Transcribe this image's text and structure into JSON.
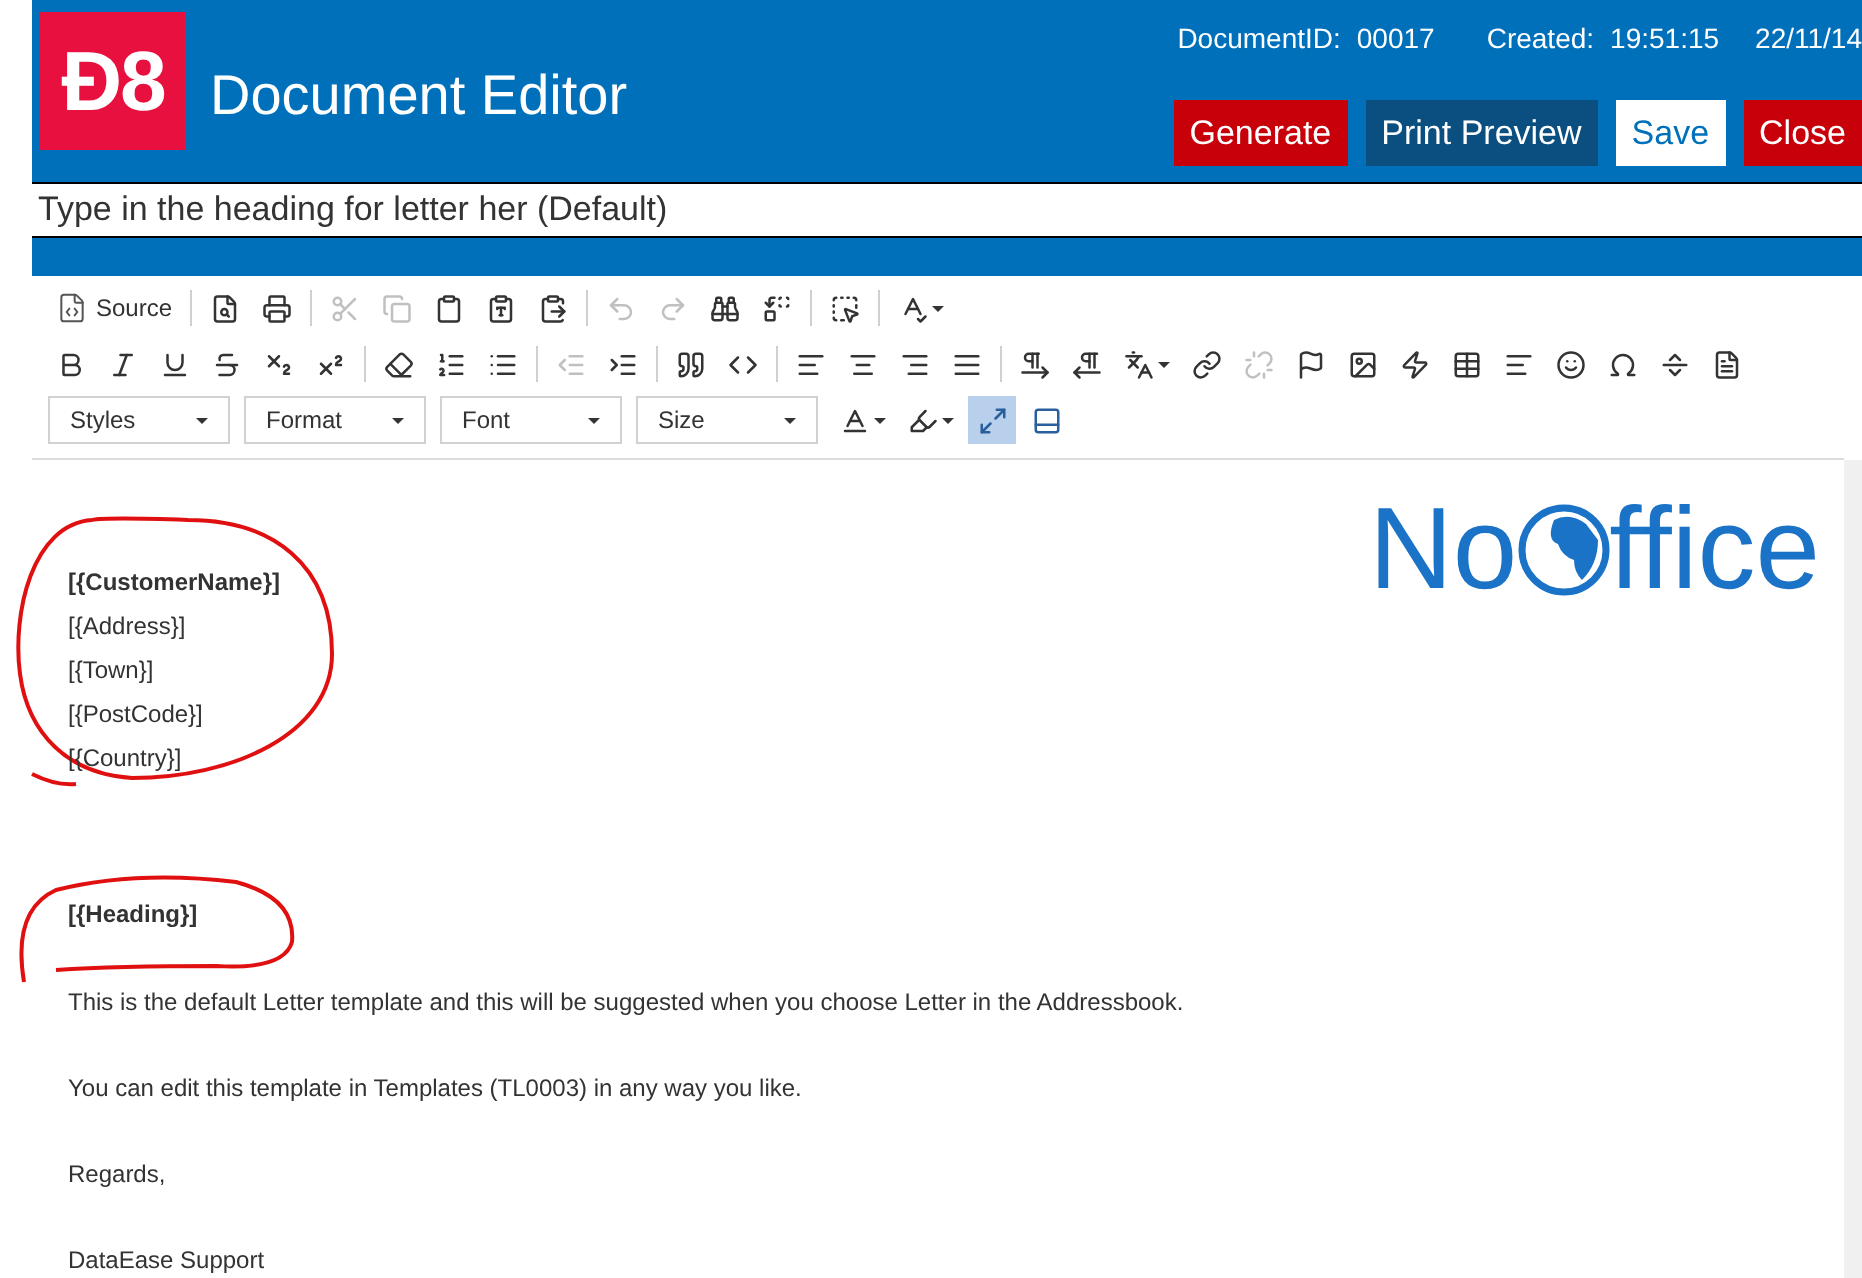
{
  "header": {
    "logo": "Đ8",
    "title": "Document Editor",
    "document_id_label": "DocumentID:",
    "document_id": "00017",
    "created_label": "Created:",
    "created_time": "19:51:15",
    "created_date": "22/11/14",
    "buttons": [
      {
        "label": "Generate",
        "kind": "danger"
      },
      {
        "label": "Print Preview",
        "kind": "dark"
      },
      {
        "label": "Save",
        "kind": "light"
      },
      {
        "label": "Close",
        "kind": "danger"
      }
    ]
  },
  "heading_field": {
    "value": "Type in the heading for letter her (Default)"
  },
  "toolbar": {
    "rows": [
      [
        {
          "kind": "source",
          "label": "Source"
        },
        {
          "kind": "separator"
        },
        {
          "kind": "icon",
          "disabled": false
        },
        {
          "kind": "icon",
          "disabled": false
        },
        {
          "kind": "separator"
        },
        {
          "kind": "icon",
          "disabled": true
        },
        {
          "kind": "icon",
          "disabled": true
        },
        {
          "kind": "icon",
          "disabled": false
        },
        {
          "kind": "icon",
          "disabled": false
        },
        {
          "kind": "icon",
          "disabled": false
        },
        {
          "kind": "separator"
        },
        {
          "kind": "icon",
          "disabled": true
        },
        {
          "kind": "icon",
          "disabled": true
        },
        {
          "kind": "icon",
          "disabled": false
        },
        {
          "kind": "icon",
          "disabled": false
        },
        {
          "kind": "separator"
        },
        {
          "kind": "icon",
          "disabled": false
        },
        {
          "kind": "separator"
        },
        {
          "kind": "icon-dropdown",
          "disabled": false
        }
      ],
      [
        {
          "kind": "icon",
          "disabled": false
        },
        {
          "kind": "icon",
          "disabled": false
        },
        {
          "kind": "icon",
          "disabled": false
        },
        {
          "kind": "icon",
          "disabled": false
        },
        {
          "kind": "icon",
          "disabled": false
        },
        {
          "kind": "icon",
          "disabled": false
        },
        {
          "kind": "separator"
        },
        {
          "kind": "icon",
          "disabled": false
        },
        {
          "kind": "icon",
          "disabled": false
        },
        {
          "kind": "icon",
          "disabled": false
        },
        {
          "kind": "separator"
        },
        {
          "kind": "icon",
          "disabled": true
        },
        {
          "kind": "icon",
          "disabled": false
        },
        {
          "kind": "separator"
        },
        {
          "kind": "icon",
          "disabled": false
        },
        {
          "kind": "icon",
          "disabled": false
        },
        {
          "kind": "separator"
        },
        {
          "kind": "icon",
          "disabled": false
        },
        {
          "kind": "icon",
          "disabled": false
        },
        {
          "kind": "icon",
          "disabled": false
        },
        {
          "kind": "icon",
          "disabled": false
        },
        {
          "kind": "separator"
        },
        {
          "kind": "icon",
          "disabled": false
        },
        {
          "kind": "icon",
          "disabled": false
        },
        {
          "kind": "icon-dropdown",
          "disabled": false
        },
        {
          "kind": "icon",
          "disabled": false
        },
        {
          "kind": "icon",
          "disabled": true
        },
        {
          "kind": "icon",
          "disabled": false
        },
        {
          "kind": "icon",
          "disabled": false
        },
        {
          "kind": "icon",
          "disabled": false
        },
        {
          "kind": "icon",
          "disabled": false
        },
        {
          "kind": "icon",
          "disabled": false
        },
        {
          "kind": "icon",
          "disabled": false
        },
        {
          "kind": "icon",
          "disabled": false
        },
        {
          "kind": "icon",
          "disabled": false
        },
        {
          "kind": "icon",
          "disabled": false
        }
      ],
      [
        {
          "kind": "combo",
          "label": "Styles"
        },
        {
          "kind": "combo",
          "label": "Format"
        },
        {
          "kind": "combo",
          "label": "Font"
        },
        {
          "kind": "combo",
          "label": "Size"
        },
        {
          "kind": "icon-dropdown",
          "disabled": false
        },
        {
          "kind": "icon-dropdown",
          "disabled": false
        },
        {
          "kind": "toggle",
          "selected": true
        },
        {
          "kind": "toggle",
          "selected": false
        }
      ]
    ]
  },
  "document": {
    "logo_start": "No",
    "logo_end": "ffice",
    "address": [
      {
        "text": "[{CustomerName}]",
        "bold": true
      },
      {
        "text": "[{Address}]",
        "bold": false
      },
      {
        "text": "[{Town}]",
        "bold": false
      },
      {
        "text": "[{PostCode}]",
        "bold": false
      },
      {
        "text": "[{Country}]",
        "bold": false
      }
    ],
    "heading": "[{Heading}]",
    "paragraphs": [
      "This is the default Letter template and this will be suggested when you choose Letter in the Addressbook.",
      "You can edit this template in Templates (TL0003) in any way you like.",
      "Regards,",
      "DataEase Support"
    ]
  }
}
